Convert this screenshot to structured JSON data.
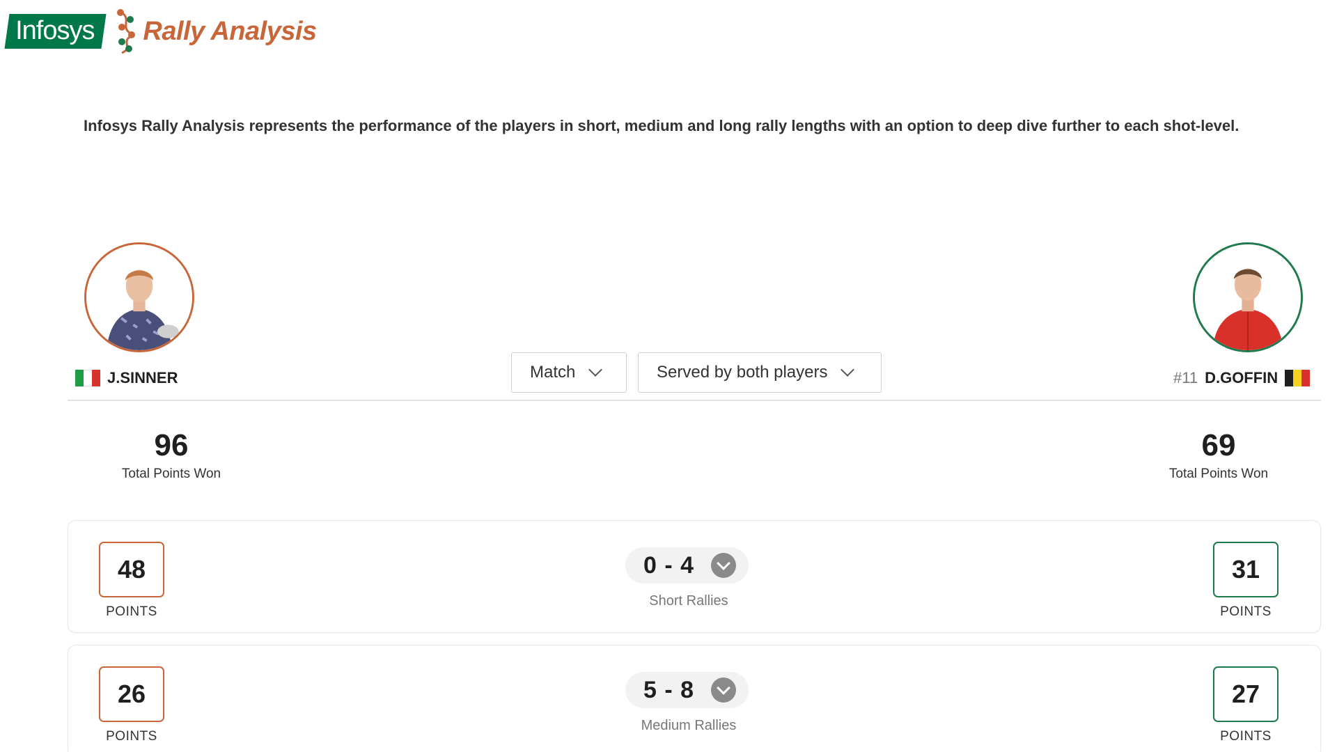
{
  "brand": {
    "company": "Infosys",
    "product": "Rally Analysis",
    "green": "#00784a",
    "orange": "#c8663a"
  },
  "intro_text": "Infosys Rally Analysis represents the performance of the players in short, medium and long rally lengths with an option to deep dive further to each shot-level.",
  "players": {
    "left": {
      "name": "J.SINNER",
      "flag": "italy-flag",
      "accent": "#c8663a"
    },
    "right": {
      "seed": "#11",
      "name": "D.GOFFIN",
      "flag": "belgium-flag",
      "accent": "#1e7a4c"
    }
  },
  "filters": {
    "period": {
      "selected": "Match"
    },
    "serve": {
      "selected": "Served by both players"
    }
  },
  "totals": {
    "left": {
      "value": "96",
      "label": "Total Points Won"
    },
    "right": {
      "value": "69",
      "label": "Total Points Won"
    }
  },
  "rallies": [
    {
      "label": "Short Rallies",
      "score": "0 - 4",
      "left_points": "48",
      "right_points": "31",
      "points_label": "POINTS"
    },
    {
      "label": "Medium Rallies",
      "score": "5 - 8",
      "left_points": "26",
      "right_points": "27",
      "points_label": "POINTS"
    }
  ]
}
